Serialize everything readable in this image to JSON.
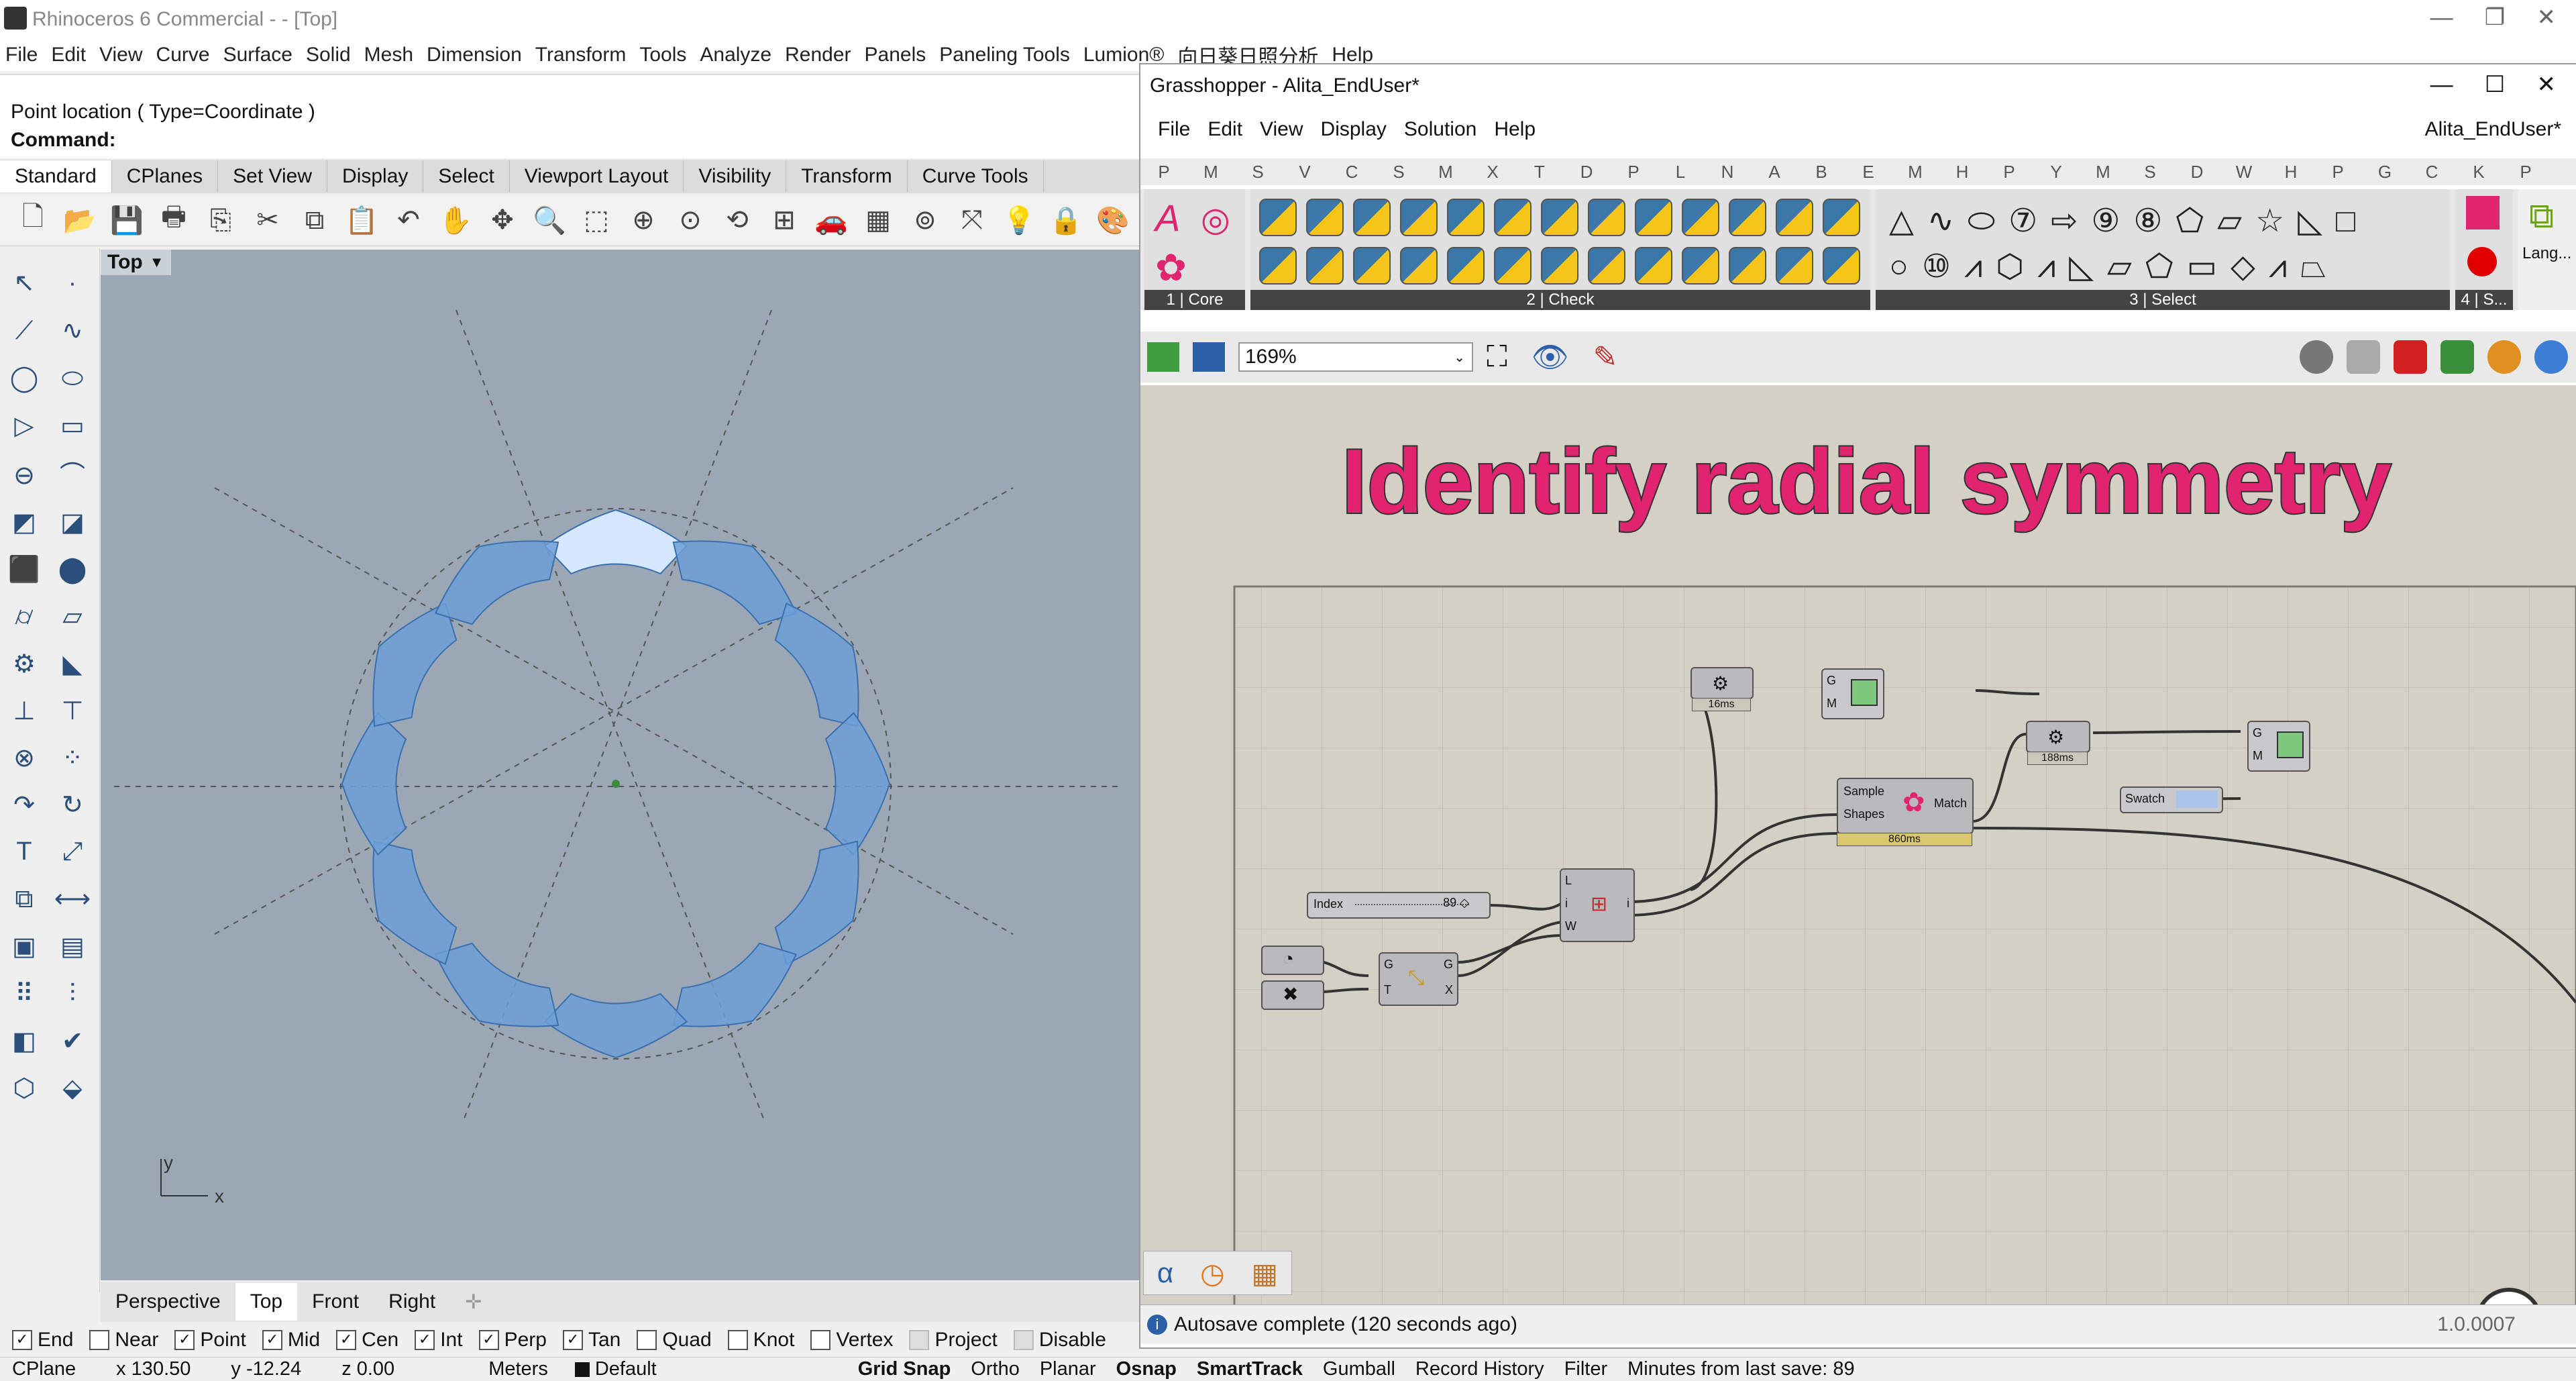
{
  "rhino": {
    "title": "Rhinoceros 6 Commercial - - [Top]",
    "menu": [
      "File",
      "Edit",
      "View",
      "Curve",
      "Surface",
      "Solid",
      "Mesh",
      "Dimension",
      "Transform",
      "Tools",
      "Analyze",
      "Render",
      "Panels",
      "Paneling Tools",
      "Lumion®",
      "向日葵日照分析",
      "Help"
    ],
    "command_history": "Point location ( Type=Coordinate )",
    "command_label": "Command:",
    "tabs": [
      "Standard",
      "CPlanes",
      "Set View",
      "Display",
      "Select",
      "Viewport Layout",
      "Visibility",
      "Transform",
      "Curve Tools"
    ],
    "active_tab": "Standard",
    "viewport_name": "Top",
    "axis_x": "x",
    "axis_y": "y",
    "viewport_tabs": [
      "Perspective",
      "Top",
      "Front",
      "Right"
    ],
    "active_viewport_tab": "Top",
    "osnaps": [
      {
        "label": "End",
        "checked": true
      },
      {
        "label": "Near",
        "checked": false
      },
      {
        "label": "Point",
        "checked": true
      },
      {
        "label": "Mid",
        "checked": true
      },
      {
        "label": "Cen",
        "checked": true
      },
      {
        "label": "Int",
        "checked": true
      },
      {
        "label": "Perp",
        "checked": true
      },
      {
        "label": "Tan",
        "checked": true
      },
      {
        "label": "Quad",
        "checked": false
      },
      {
        "label": "Knot",
        "checked": false
      },
      {
        "label": "Vertex",
        "checked": false
      },
      {
        "label": "Project",
        "checked": false,
        "disabled": true
      },
      {
        "label": "Disable",
        "checked": false,
        "disabled": true
      }
    ],
    "status": {
      "cplane": "CPlane",
      "x": "x 130.50",
      "y": "y -12.24",
      "z": "z 0.00",
      "units": "Meters",
      "layer": "Default",
      "toggles": [
        "Grid Snap",
        "Ortho",
        "Planar",
        "Osnap",
        "SmartTrack",
        "Gumball",
        "Record History",
        "Filter"
      ],
      "bold_toggles": [
        "Grid Snap",
        "Osnap",
        "SmartTrack"
      ],
      "last_save": "Minutes from last save: 89"
    }
  },
  "gh": {
    "title": "Grasshopper - Alita_EndUser*",
    "menu": [
      "File",
      "Edit",
      "View",
      "Display",
      "Solution",
      "Help"
    ],
    "doc_name": "Alita_EndUser*",
    "categories": [
      "P",
      "M",
      "S",
      "V",
      "C",
      "S",
      "M",
      "X",
      "T",
      "D",
      "P",
      "L",
      "N",
      "A",
      "B",
      "E",
      "M",
      "H",
      "P",
      "Y",
      "M",
      "S",
      "D",
      "W",
      "H",
      "P",
      "G",
      "C",
      "K",
      "P"
    ],
    "panels": [
      "1 | Core",
      "2 | Check",
      "3 | Select",
      "4 | S...",
      "Lang..."
    ],
    "zoom": "169%",
    "canvas_title": "Identify radial symmetry",
    "components": {
      "index_label": "Index",
      "index_value": "89 ◇",
      "t1": "16ms",
      "t2": "188ms",
      "t3": "860ms",
      "sample": "Sample",
      "shapes": "Shapes",
      "match": "Match",
      "swatch": "Swatch",
      "g": "G",
      "m": "M",
      "t": "T",
      "x": "X",
      "l": "L",
      "i": "i",
      "w": "W"
    },
    "status_msg": "Autosave complete (120 seconds ago)",
    "version": "1.0.0007"
  },
  "colors": {
    "canvas_title": "#e0246f",
    "viewport_bg": "#9ba7b5",
    "petal_fill": "#6d9fd6",
    "petal_selected": "#d6e8ff",
    "gh_canvas": "#d4d0c6"
  }
}
